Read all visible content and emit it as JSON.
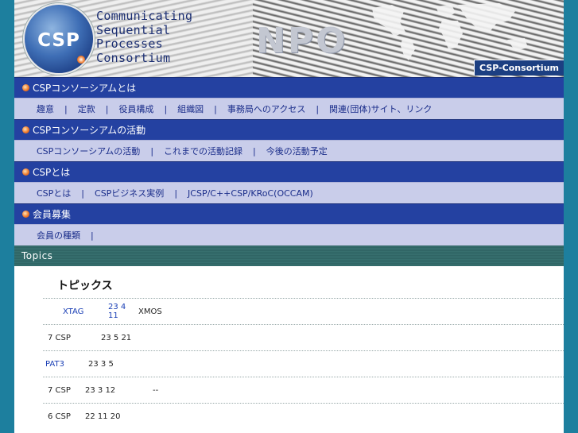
{
  "header": {
    "logo_text": "CSP",
    "tagline": [
      "Communicating",
      "Sequential",
      "Processes",
      "Consortium"
    ],
    "npo": "NPO",
    "badge": "CSP-Consortium"
  },
  "nav": [
    {
      "title": "CSPコンソーシアムとは",
      "links": [
        "趣意",
        "定款",
        "役員構成",
        "組織図",
        "事務局へのアクセス",
        "関連(団体)サイト、リンク"
      ]
    },
    {
      "title": "CSPコンソーシアムの活動",
      "links": [
        "CSPコンソーシアムの活動",
        "これまでの活動記録",
        "今後の活動予定"
      ]
    },
    {
      "title": "CSPとは",
      "links": [
        "CSPとは",
        "CSPビジネス実例",
        "JCSP/C++CSP/KRoC(OCCAM)"
      ]
    },
    {
      "title": "会員募集",
      "links": [
        "会員の種類"
      ]
    }
  ],
  "topics_bar": "Topics",
  "topics_title": "トピックス",
  "news": [
    {
      "a": "XTAG",
      "b": "23 4 11",
      "c": "XMOS"
    },
    {
      "a": "7  CSP",
      "b": "23 5 21",
      "c": ""
    },
    {
      "a": "PAT3",
      "b": "23 3 5",
      "c": ""
    },
    {
      "a": "7  CSP",
      "b": "23 3 12",
      "c": "--"
    },
    {
      "a": "6  CSP",
      "b": "22 11 20",
      "c": ""
    }
  ],
  "colors": {
    "page_bg": "#1d7f9e",
    "nav_header": "#2441a1",
    "nav_sub": "#c9cdea",
    "topics_bar": "#3f7c7b"
  }
}
